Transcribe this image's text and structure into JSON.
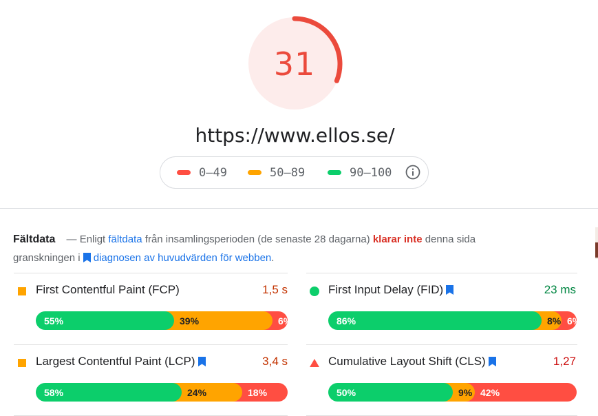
{
  "score": {
    "value": "31",
    "fraction": 0.31,
    "color": "#eb4a3c"
  },
  "url": "https://www.ellos.se/",
  "legend": {
    "items": [
      {
        "label": "0–49",
        "color": "#ff4e42"
      },
      {
        "label": "50–89",
        "color": "#ffa400"
      },
      {
        "label": "90–100",
        "color": "#0cce6b"
      }
    ],
    "info_icon": "info-icon"
  },
  "field_data": {
    "title": "Fältdata",
    "dash": "—",
    "text_1": "Enligt",
    "link_1": "fältdata",
    "text_2": "från insamlingsperioden (de senaste 28 dagarna)",
    "status": "klarar inte",
    "text_3": "denna sida granskningen i",
    "link_2": "diagnosen av huvudvärden för webben",
    "text_4": "."
  },
  "metrics": [
    {
      "name": "First Contentful Paint (FCP)",
      "value": "1,5 s",
      "value_color": "#c33300",
      "icon": "orange-square-icon",
      "core": false,
      "good": "55%",
      "ni": "39%",
      "poor": "6%",
      "good_frac": 0.55,
      "ni_frac": 0.39,
      "poor_frac": 0.06
    },
    {
      "name": "First Input Delay (FID)",
      "value": "23 ms",
      "value_color": "#018642",
      "icon": "green-circle-icon",
      "core": true,
      "good": "86%",
      "ni": "8%",
      "poor": "6%",
      "good_frac": 0.86,
      "ni_frac": 0.08,
      "poor_frac": 0.06
    },
    {
      "name": "Largest Contentful Paint (LCP)",
      "value": "3,4 s",
      "value_color": "#c33300",
      "icon": "orange-square-icon",
      "core": true,
      "good": "58%",
      "ni": "24%",
      "poor": "18%",
      "good_frac": 0.58,
      "ni_frac": 0.24,
      "poor_frac": 0.18
    },
    {
      "name": "Cumulative Layout Shift (CLS)",
      "value": "1,27",
      "value_color": "#cc0f0f",
      "icon": "red-triangle-icon",
      "core": true,
      "good": "50%",
      "ni": "9%",
      "poor": "42%",
      "good_frac": 0.5,
      "ni_frac": 0.09,
      "poor_frac": 0.42
    }
  ]
}
